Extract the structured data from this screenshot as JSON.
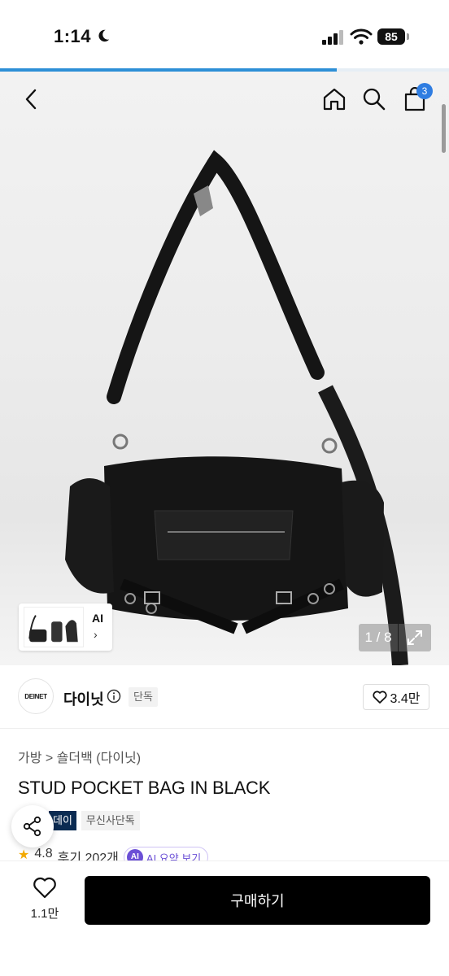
{
  "status_bar": {
    "time": "1:14",
    "battery": "85"
  },
  "load_progress": 0.75,
  "nav": {
    "cart_count": "3"
  },
  "gallery": {
    "page_current": "1",
    "page_total": "8",
    "page_label": "1 / 8",
    "thumb_ai_label": "AI",
    "thumb_chevron": "›"
  },
  "brand": {
    "logo_text": "DEINET",
    "name": "다이닛",
    "exclusive": "단독",
    "likes": "3.4만"
  },
  "product": {
    "breadcrumb": "가방 > 숄더백 (다이닛)",
    "title": "STUD POCKET BAG IN BLACK",
    "tags": [
      "데이",
      "무신사단독"
    ],
    "rating": "4.8",
    "reviews": "후기 202개",
    "ai_badge": "AI",
    "ai_summary": "AI 요약 보기"
  },
  "bottom_bar": {
    "wish_count": "1.1만",
    "buy_label": "구매하기"
  },
  "colors": {
    "progress": "#2d8fd6",
    "cart_badge": "#2f7de1",
    "buy_button": "#000000",
    "tag_dark": "#0b2b52"
  }
}
